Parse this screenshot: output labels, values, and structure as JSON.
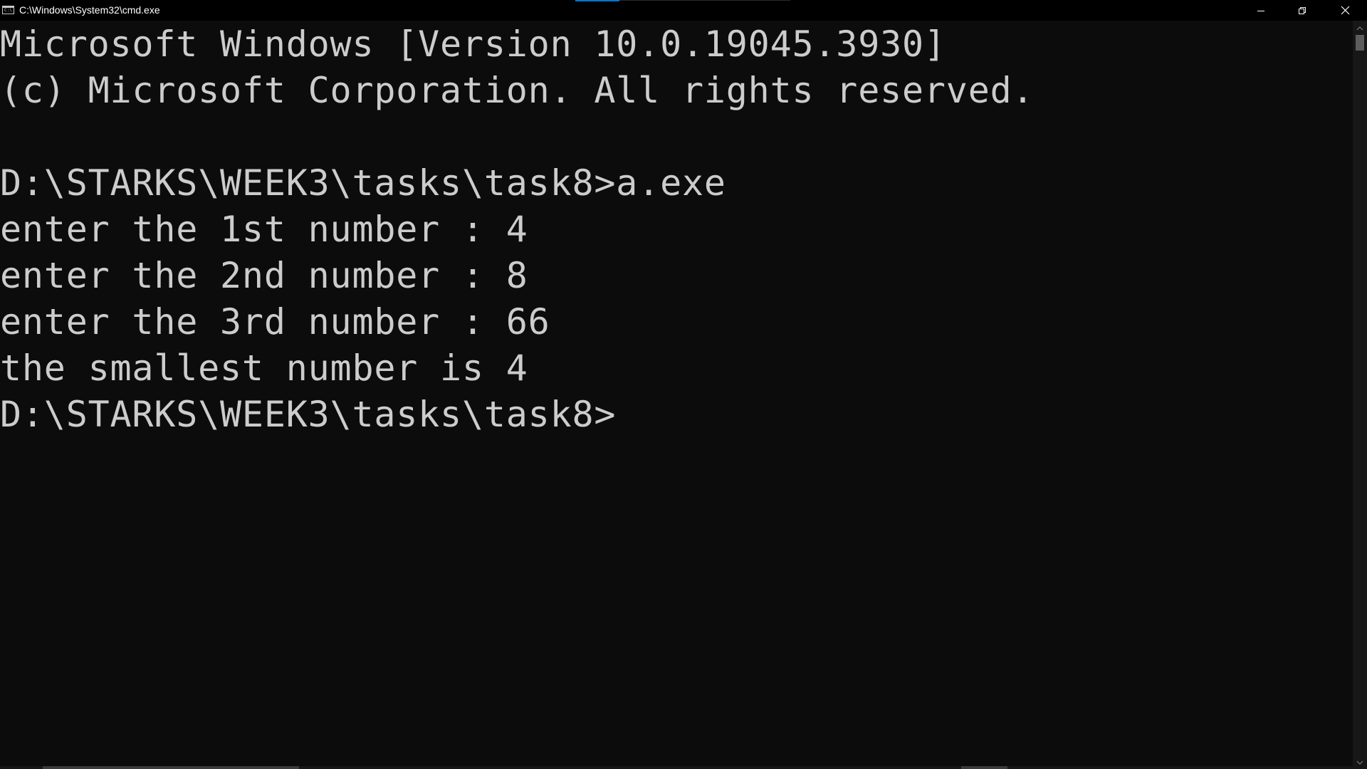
{
  "window": {
    "title": "C:\\Windows\\System32\\cmd.exe",
    "icon": "cmd-icon",
    "icon_text": "C:\\",
    "buttons": {
      "minimize": "minimize-icon",
      "maximize": "restore-icon",
      "close": "close-icon"
    }
  },
  "console": {
    "lines": [
      "Microsoft Windows [Version 10.0.19045.3930]",
      "(c) Microsoft Corporation. All rights reserved.",
      "",
      "D:\\STARKS\\WEEK3\\tasks\\task8>a.exe",
      "enter the 1st number : 4",
      "enter the 2nd number : 8",
      "enter the 3rd number : 66",
      "the smallest number is 4",
      "D:\\STARKS\\WEEK3\\tasks\\task8>"
    ]
  },
  "colors": {
    "background": "#0c0c0c",
    "text": "#cccccc",
    "titlebar": "#000000",
    "accent": "#0078d4"
  }
}
